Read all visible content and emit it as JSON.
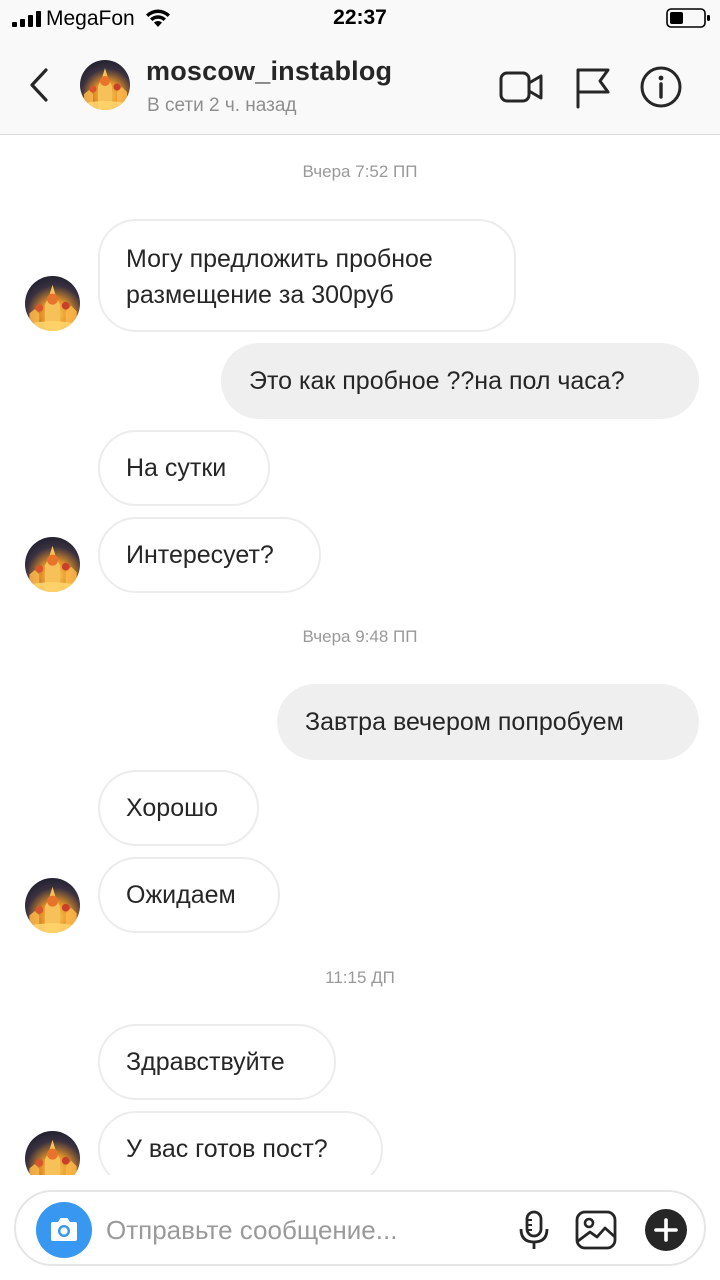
{
  "status_bar": {
    "carrier": "MegaFon",
    "time": "22:37"
  },
  "header": {
    "username": "moscow_instablog",
    "status": "В сети 2 ч. назад"
  },
  "messages": {
    "ts1": "Вчера 7:52 ПП",
    "m1_line1": "Могу предложить пробное",
    "m1_line2": "размещение за 300руб",
    "m2": "Это как пробное ??на пол часа?",
    "m3": "На сутки",
    "m4": "Интересует?",
    "ts2": "Вчера 9:48 ПП",
    "m5": "Завтра вечером попробуем",
    "m6": "Хорошо",
    "m7": "Ожидаем",
    "ts3": "11:15 ДП",
    "m8": "Здравствуйте",
    "m9": "У вас готов пост?"
  },
  "composer": {
    "placeholder": "Отправьте сообщение..."
  },
  "icons": {
    "back": "chevron-left-icon",
    "video": "video-camera-icon",
    "flag": "flag-icon",
    "info": "info-icon",
    "camera": "camera-icon",
    "mic": "microphone-icon",
    "gallery": "image-icon",
    "plus": "plus-icon"
  },
  "colors": {
    "accent": "#3897f0",
    "outgoing_bubble": "#efefef",
    "incoming_border": "#ececec",
    "secondary_text": "#8e8e8e"
  }
}
